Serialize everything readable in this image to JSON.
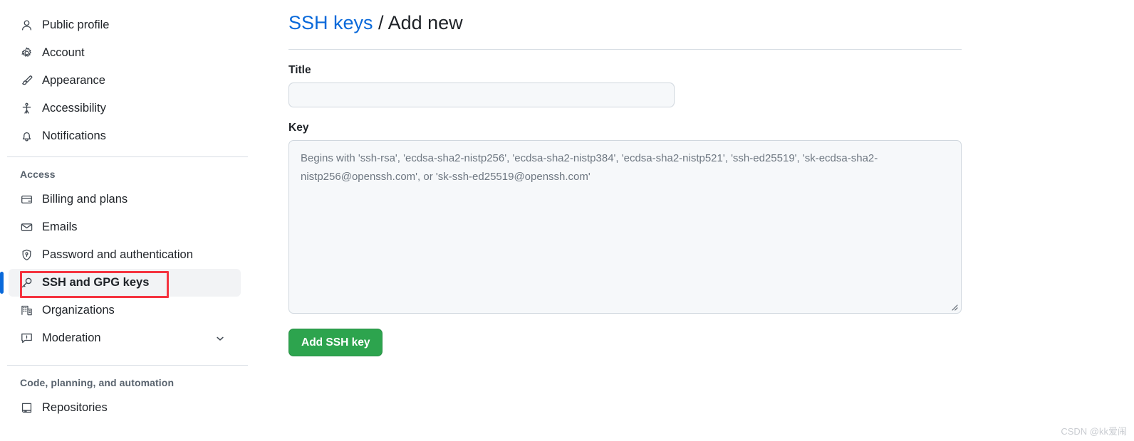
{
  "sidebar": {
    "personal_items": [
      {
        "label": "Public profile",
        "icon": "person-icon",
        "name": "sidebar-item-public-profile"
      },
      {
        "label": "Account",
        "icon": "gear-icon",
        "name": "sidebar-item-account"
      },
      {
        "label": "Appearance",
        "icon": "paintbrush-icon",
        "name": "sidebar-item-appearance"
      },
      {
        "label": "Accessibility",
        "icon": "accessibility-icon",
        "name": "sidebar-item-accessibility"
      },
      {
        "label": "Notifications",
        "icon": "bell-icon",
        "name": "sidebar-item-notifications"
      }
    ],
    "access_group_title": "Access",
    "access_items": [
      {
        "label": "Billing and plans",
        "icon": "credit-card-icon",
        "name": "sidebar-item-billing-and-plans",
        "selected": false,
        "chevron": false
      },
      {
        "label": "Emails",
        "icon": "envelope-icon",
        "name": "sidebar-item-emails",
        "selected": false,
        "chevron": false
      },
      {
        "label": "Password and authentication",
        "icon": "shield-lock-icon",
        "name": "sidebar-item-password-and-authentication",
        "selected": false,
        "chevron": false
      },
      {
        "label": "SSH and GPG keys",
        "icon": "key-icon",
        "name": "sidebar-item-ssh-and-gpg-keys",
        "selected": true,
        "chevron": false,
        "annotated": true
      },
      {
        "label": "Organizations",
        "icon": "organization-icon",
        "name": "sidebar-item-organizations",
        "selected": false,
        "chevron": false
      },
      {
        "label": "Moderation",
        "icon": "report-icon",
        "name": "sidebar-item-moderation",
        "selected": false,
        "chevron": true
      }
    ],
    "code_group_title": "Code, planning, and automation",
    "code_items": [
      {
        "label": "Repositories",
        "icon": "repo-icon",
        "name": "sidebar-item-repositories"
      }
    ]
  },
  "header": {
    "breadcrumb_link": "SSH keys",
    "breadcrumb_separator": "/",
    "breadcrumb_current": "Add new"
  },
  "form": {
    "title_label": "Title",
    "title_value": "",
    "title_placeholder": "",
    "key_label": "Key",
    "key_value": "",
    "key_placeholder": "Begins with 'ssh-rsa', 'ecdsa-sha2-nistp256', 'ecdsa-sha2-nistp384', 'ecdsa-sha2-nistp521', 'ssh-ed25519', 'sk-ecdsa-sha2-nistp256@openssh.com', or 'sk-ssh-ed25519@openssh.com'",
    "submit_label": "Add SSH key"
  },
  "colors": {
    "accent_link": "#0969da",
    "selected_bar": "#0969da",
    "primary_button": "#2da44e",
    "annotation_red": "#f5333f",
    "input_background": "#f6f8fa",
    "border": "#d0d7de"
  },
  "watermark": {
    "text": "CSDN @kk爱闹"
  }
}
